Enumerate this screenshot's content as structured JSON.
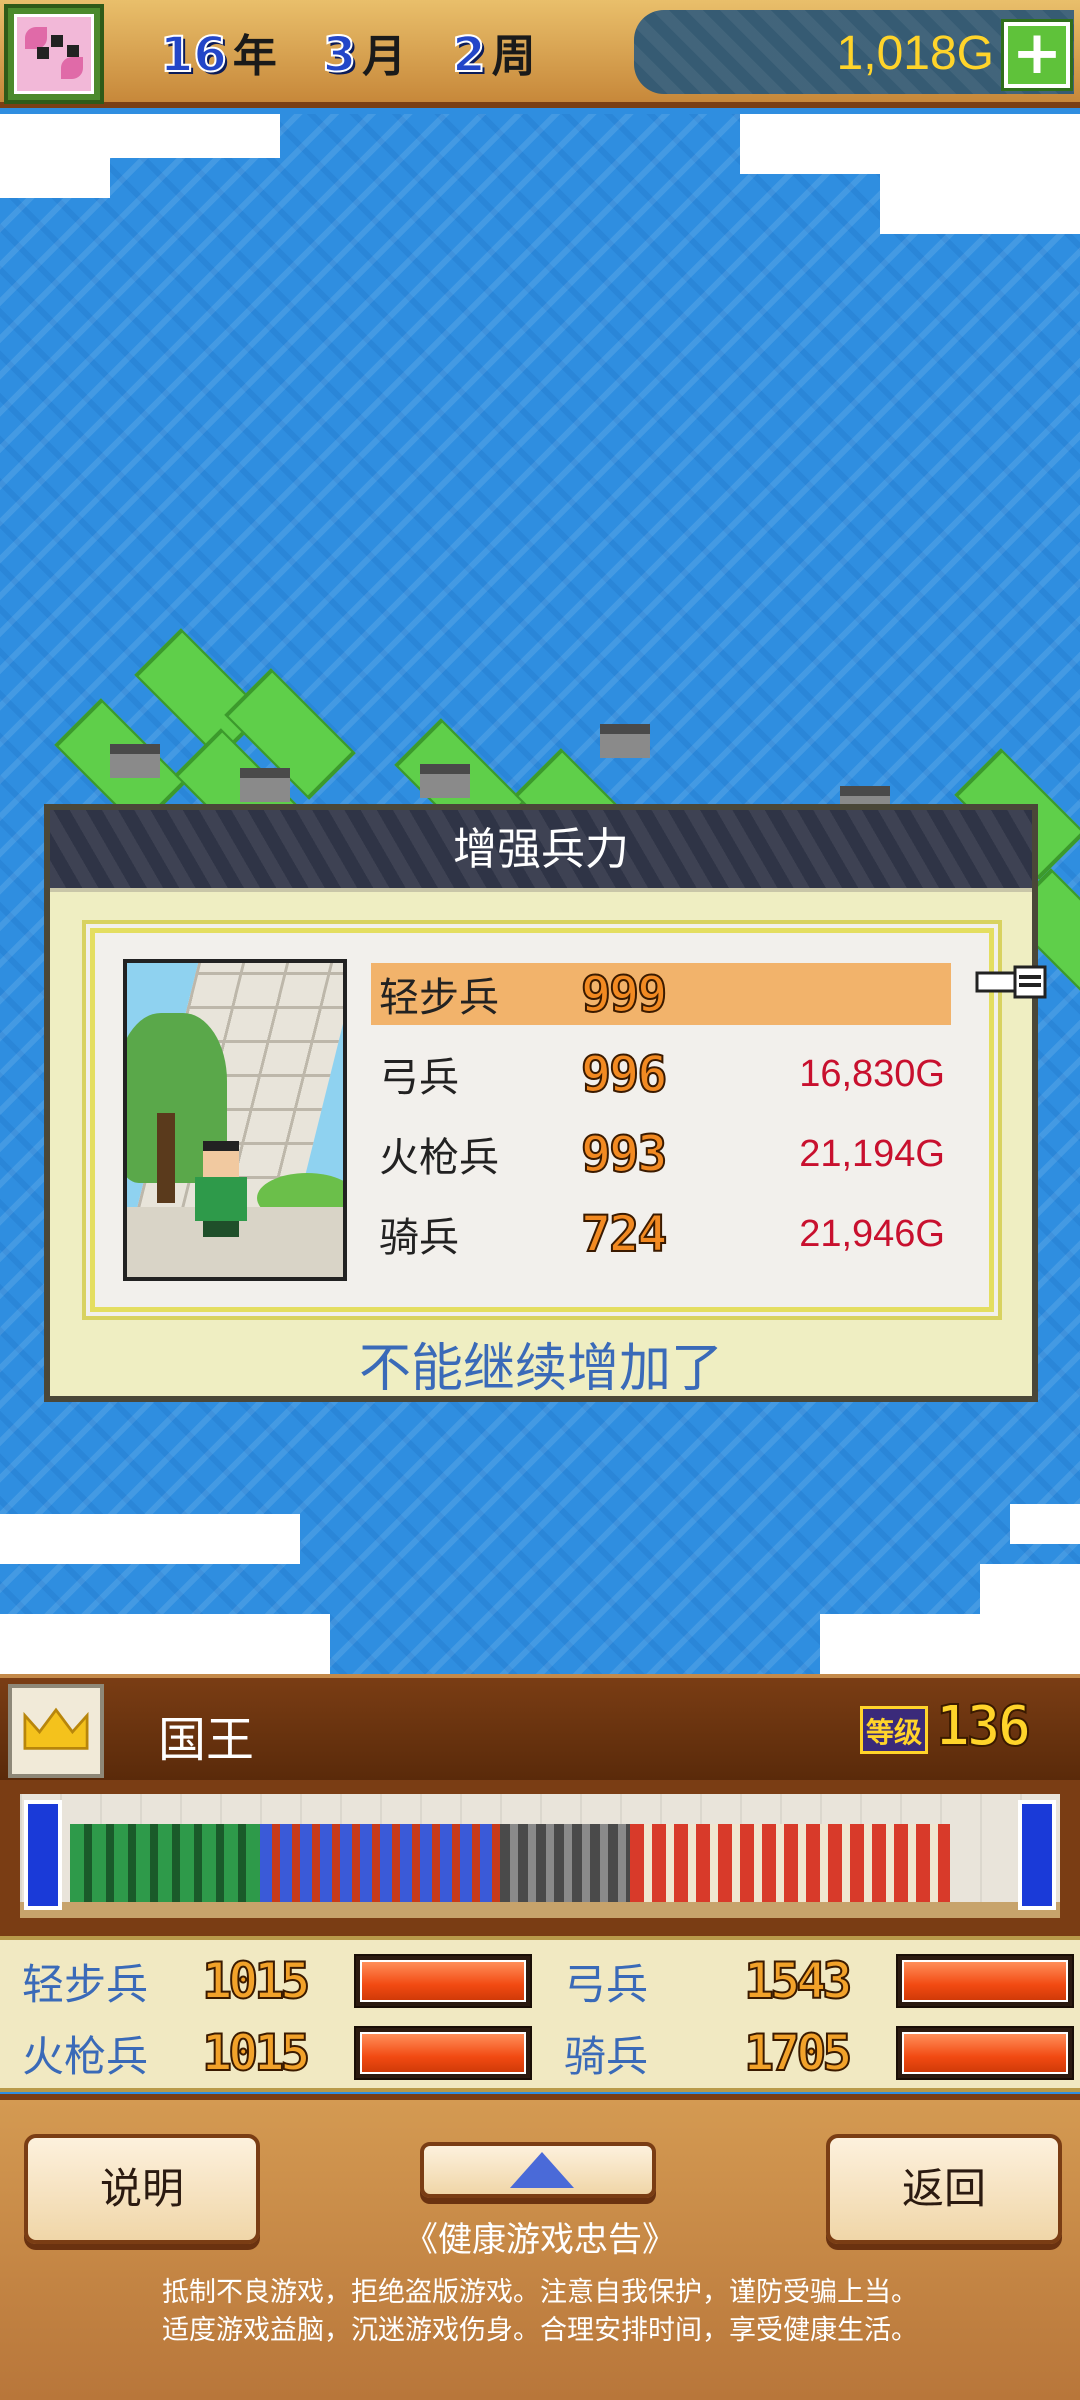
{
  "header": {
    "year_num": "16",
    "year_unit": "年",
    "month_num": "3",
    "month_unit": "月",
    "week_num": "2",
    "week_unit": "周",
    "gold": "1,018G",
    "add_icon": "plus-icon"
  },
  "dialog": {
    "title": "增强兵力",
    "units": [
      {
        "name": "轻步兵",
        "count": "999",
        "cost": ""
      },
      {
        "name": "弓兵",
        "count": "996",
        "cost": "16,830G"
      },
      {
        "name": "火枪兵",
        "count": "993",
        "cost": "21,194G"
      },
      {
        "name": "骑兵",
        "count": "724",
        "cost": "21,946G"
      }
    ],
    "selected_index": 0,
    "message": "不能继续增加了"
  },
  "king": {
    "name": "国王",
    "level_label": "等级",
    "level": "136",
    "icon": "crown-icon"
  },
  "stats": [
    {
      "name": "轻步兵",
      "value": "1015",
      "fill": 1.0
    },
    {
      "name": "弓兵",
      "value": "1543",
      "fill": 1.0
    },
    {
      "name": "火枪兵",
      "value": "1015",
      "fill": 1.0
    },
    {
      "name": "骑兵",
      "value": "1705",
      "fill": 1.0
    }
  ],
  "footer": {
    "help_label": "说明",
    "back_label": "返回",
    "health_title": "《健康游戏忠告》",
    "health_line1": "抵制不良游戏，拒绝盗版游戏。注意自我保护，谨防受骗上当。",
    "health_line2": "适度游戏益脑，沉迷游戏伤身。合理安排时间，享受健康生活。"
  },
  "colors": {
    "accent_gold": "#ffd42a",
    "cost_red": "#c8102e",
    "message_blue": "#3a6ab8",
    "selected_row": "#f2b36b"
  }
}
